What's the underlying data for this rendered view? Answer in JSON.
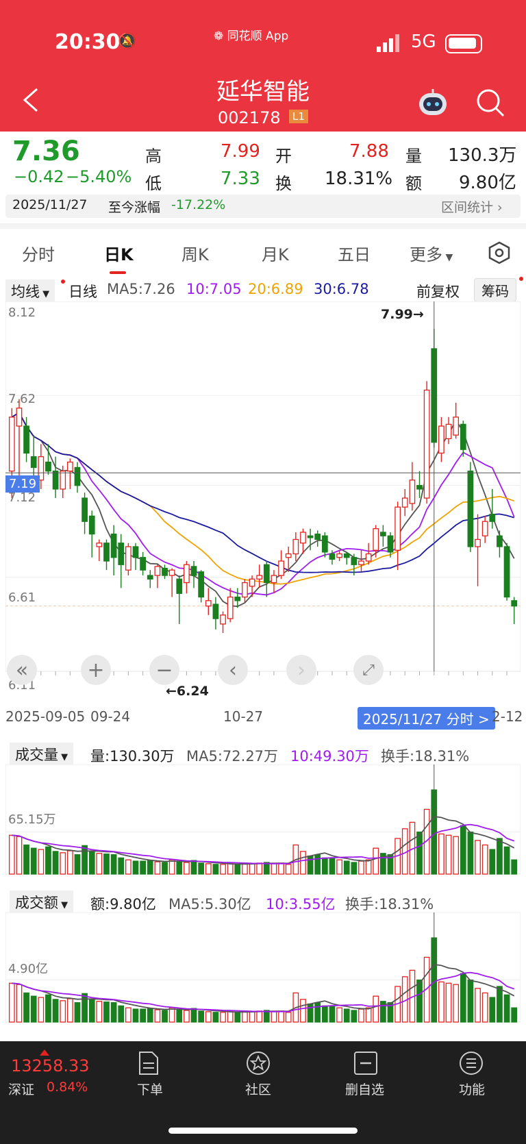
{
  "status": {
    "time": "20:30",
    "app": "同花顺 App",
    "network": "5G"
  },
  "header": {
    "title": "延华智能",
    "code": "002178",
    "level": "L1"
  },
  "quote": {
    "price": "7.36",
    "change": "−0.42",
    "change_pct": "−5.40%",
    "high_label": "高",
    "high": "7.99",
    "open_label": "开",
    "open": "7.88",
    "volume_label": "量",
    "volume": "130.3万",
    "low_label": "低",
    "low": "7.33",
    "turnover_label": "换",
    "turnover": "18.31%",
    "amount_label": "额",
    "amount": "9.80亿",
    "date": "2025/11/27",
    "since_label": "至今涨幅",
    "since_value": "-17.22%",
    "range_stats": "区间统计"
  },
  "tabs": [
    "分时",
    "日K",
    "周K",
    "月K",
    "五日",
    "更多"
  ],
  "kline_legend": {
    "ma_btn": "均线",
    "period": "日线",
    "ma5": "MA5:7.26",
    "ma10": "10:7.05",
    "ma20": "20:6.89",
    "ma30": "30:6.78",
    "adjust": "前复权",
    "chips": "筹码"
  },
  "kline_axis": {
    "y_top": "8.12",
    "y_762": "7.62",
    "y_719": "7.19",
    "y_712": "7.12",
    "y_661": "6.61",
    "y_611": "6.11",
    "max_mark": "7.99→",
    "min_mark": "←6.24",
    "x_start": "2025-09-05",
    "x_mid1": "09-24",
    "x_mid2": "10-27",
    "x_end": "2-12",
    "cursor_label": "2025/11/27 分时 >"
  },
  "volume_panel": {
    "btn": "成交量",
    "v": "量:130.30万",
    "ma5": "MA5:72.27万",
    "ma10": "10:49.30万",
    "turnover": "换手:18.31%",
    "tick": "65.15万"
  },
  "amount_panel": {
    "btn": "成交额",
    "v": "额:9.80亿",
    "ma5": "MA5:5.30亿",
    "ma10": "10:3.55亿",
    "turnover": "换手:18.31%",
    "tick": "4.90亿"
  },
  "bottom": {
    "index_value": "13258.33",
    "index_name": "深证",
    "index_pct": "0.84%",
    "nav": [
      "下单",
      "社区",
      "删自选",
      "功能"
    ]
  },
  "colors": {
    "up": "#e3231f",
    "down": "#1a7f1f",
    "ma5": "#555555",
    "ma10": "#a01bf0",
    "ma20": "#f0a300",
    "ma30": "#1a1aa0",
    "brand": "#ea3540"
  },
  "chart_data": {
    "type": "candlestick",
    "ylim": [
      6.11,
      8.12
    ],
    "candles": [
      [
        7.2,
        7.5,
        7.55,
        7.05
      ],
      [
        7.45,
        7.55,
        7.6,
        7.1
      ],
      [
        7.45,
        7.3,
        7.5,
        7.25
      ],
      [
        7.28,
        7.22,
        7.4,
        7.15
      ],
      [
        7.15,
        7.28,
        7.35,
        7.1
      ],
      [
        7.25,
        7.2,
        7.35,
        7.18
      ],
      [
        7.2,
        7.1,
        7.28,
        7.05
      ],
      [
        7.1,
        7.2,
        7.23,
        7.05
      ],
      [
        7.2,
        7.25,
        7.27,
        7.1
      ],
      [
        7.22,
        7.12,
        7.25,
        7.08
      ],
      [
        7.05,
        6.92,
        7.08,
        6.85
      ],
      [
        6.95,
        6.85,
        6.98,
        6.72
      ],
      [
        6.78,
        6.8,
        6.82,
        6.7
      ],
      [
        6.8,
        6.7,
        6.82,
        6.65
      ],
      [
        6.85,
        6.72,
        6.9,
        6.62
      ],
      [
        6.8,
        6.68,
        6.85,
        6.55
      ],
      [
        6.65,
        6.78,
        6.8,
        6.62
      ],
      [
        6.78,
        6.72,
        6.8,
        6.65
      ],
      [
        6.72,
        6.65,
        6.75,
        6.62
      ],
      [
        6.62,
        6.6,
        6.65,
        6.55
      ],
      [
        6.62,
        6.67,
        6.68,
        6.55
      ],
      [
        6.66,
        6.62,
        6.68,
        6.6
      ],
      [
        6.62,
        6.65,
        6.66,
        6.5
      ],
      [
        6.6,
        6.52,
        6.62,
        6.35
      ],
      [
        6.58,
        6.68,
        6.7,
        6.52
      ],
      [
        6.67,
        6.62,
        6.7,
        6.55
      ],
      [
        6.64,
        6.5,
        6.65,
        6.47
      ],
      [
        6.45,
        6.48,
        6.55,
        6.4
      ],
      [
        6.46,
        6.38,
        6.5,
        6.32
      ],
      [
        6.35,
        6.4,
        6.42,
        6.3
      ],
      [
        6.38,
        6.5,
        6.55,
        6.36
      ],
      [
        6.5,
        6.48,
        6.55,
        6.44
      ],
      [
        6.5,
        6.58,
        6.6,
        6.47
      ],
      [
        6.56,
        6.6,
        6.62,
        6.5
      ],
      [
        6.6,
        6.62,
        6.68,
        6.55
      ],
      [
        6.68,
        6.58,
        6.7,
        6.5
      ],
      [
        6.58,
        6.62,
        6.65,
        6.52
      ],
      [
        6.62,
        6.7,
        6.76,
        6.6
      ],
      [
        6.72,
        6.74,
        6.78,
        6.64
      ],
      [
        6.74,
        6.82,
        6.86,
        6.7
      ],
      [
        6.8,
        6.86,
        6.88,
        6.74
      ],
      [
        6.84,
        6.83,
        6.88,
        6.76
      ],
      [
        6.85,
        6.82,
        6.87,
        6.78
      ],
      [
        6.84,
        6.75,
        6.86,
        6.72
      ],
      [
        6.74,
        6.71,
        6.76,
        6.68
      ],
      [
        6.72,
        6.74,
        6.76,
        6.7
      ],
      [
        6.74,
        6.72,
        6.75,
        6.68
      ],
      [
        6.72,
        6.68,
        6.74,
        6.62
      ],
      [
        6.68,
        6.7,
        6.76,
        6.64
      ],
      [
        6.7,
        6.74,
        6.8,
        6.68
      ],
      [
        6.76,
        6.88,
        6.9,
        6.72
      ],
      [
        6.86,
        6.84,
        6.9,
        6.78
      ],
      [
        6.84,
        6.75,
        6.86,
        6.72
      ],
      [
        6.76,
        7.0,
        7.03,
        6.65
      ],
      [
        7.0,
        7.05,
        7.1,
        6.95
      ],
      [
        7.02,
        7.15,
        7.25,
        6.98
      ],
      [
        7.12,
        7.1,
        7.2,
        7.05
      ],
      [
        7.05,
        7.65,
        7.7,
        7.02
      ],
      [
        7.88,
        7.36,
        7.99,
        7.33
      ],
      [
        7.3,
        7.45,
        7.5,
        7.25
      ],
      [
        7.38,
        7.46,
        7.5,
        7.35
      ],
      [
        7.4,
        7.5,
        7.58,
        7.38
      ],
      [
        7.46,
        7.32,
        7.48,
        7.28
      ],
      [
        7.2,
        6.78,
        7.25,
        6.75
      ],
      [
        6.78,
        6.82,
        6.96,
        6.56
      ],
      [
        6.84,
        6.92,
        6.95,
        6.8
      ],
      [
        6.96,
        6.92,
        7.1,
        6.88
      ],
      [
        6.84,
        6.78,
        6.87,
        6.72
      ],
      [
        6.78,
        6.5,
        6.8,
        6.48
      ],
      [
        6.48,
        6.45,
        6.5,
        6.35
      ]
    ],
    "volume_ylim": [
      0,
      165
    ],
    "volume": [
      60,
      58,
      45,
      40,
      38,
      42,
      35,
      33,
      36,
      30,
      44,
      35,
      32,
      31,
      30,
      25,
      22,
      20,
      20,
      21,
      19,
      18,
      22,
      20,
      18,
      21,
      17,
      16,
      15,
      15,
      16,
      15,
      17,
      16,
      17,
      18,
      16,
      17,
      15,
      45,
      35,
      28,
      30,
      25,
      24,
      22,
      20,
      18,
      20,
      22,
      40,
      32,
      30,
      55,
      70,
      80,
      65,
      100,
      130,
      62,
      60,
      58,
      75,
      65,
      52,
      45,
      38,
      55,
      42,
      22
    ]
  }
}
